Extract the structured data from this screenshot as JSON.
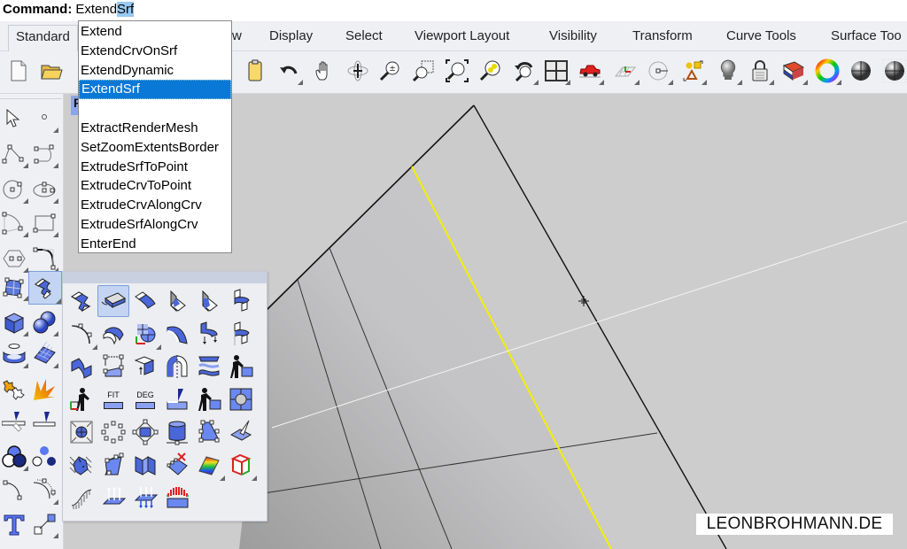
{
  "command": {
    "label": "Command:",
    "typed_prefix": "Extend",
    "autocomplete_suffix": "Srf"
  },
  "tabs": [
    {
      "label": "Standard",
      "active": true
    },
    {
      "label": "View",
      "visible_label": "w"
    },
    {
      "label": "Display"
    },
    {
      "label": "Select"
    },
    {
      "label": "Viewport Layout"
    },
    {
      "label": "Visibility"
    },
    {
      "label": "Transform"
    },
    {
      "label": "Curve Tools"
    },
    {
      "label": "Surface Tools",
      "visible_label": "Surface Too"
    }
  ],
  "autocomplete": {
    "items": [
      "Extend",
      "ExtendCrvOnSrf",
      "ExtendDynamic",
      "ExtendSrf",
      "",
      "ExtractRenderMesh",
      "SetZoomExtentsBorder",
      "ExtrudeSrfToPoint",
      "ExtrudeCrvToPoint",
      "ExtrudeCrvAlongCrv",
      "ExtrudeSrfAlongCrv",
      "EnterEnd"
    ],
    "selected_index": 3,
    "selected_color": "#0a78d7"
  },
  "toolbar": {
    "icons": [
      "new-document-icon",
      "open-folder-icon",
      "save-icon",
      "paste-icon",
      "undo-icon",
      "pan-hand-icon",
      "rotate-view-icon",
      "zoom-dynamic-icon",
      "zoom-window-icon",
      "zoom-extents-icon",
      "zoom-selected-icon",
      "undo-view-change-icon",
      "four-viewports-icon",
      "named-views-car-icon",
      "construction-plane-icon",
      "osnap-icon",
      "select-objects-icon",
      "lights-icon",
      "lock-icon",
      "layer-properties-icon",
      "color-wheel-icon",
      "shaded-viewport-icon",
      "rendered-viewport-icon"
    ]
  },
  "sidebar": {
    "icons": [
      "select-arrow-icon",
      "point-icon",
      "polyline-icon",
      "curve-icon",
      "circle-icon",
      "ellipse-icon",
      "arc-icon",
      "rectangle-icon",
      "polygon-icon",
      "fillet-curves-icon",
      "surface-from-points-icon",
      "extend-surface-icon",
      "box-solid-icon",
      "sphere-union-icon",
      "cylinder-mesh-icon",
      "mesh-plane-icon",
      "explode-join-icon",
      "boolean-split-icon",
      "trim-icon",
      "split-icon",
      "boolean-union-icon",
      "boolean-difference-icon",
      "offset-curve-icon",
      "blend-curve-icon",
      "text-object-icon",
      "scale-transform-icon"
    ],
    "selected": "extend-surface-icon"
  },
  "viewport": {
    "tab_label": "P",
    "watermark": "LEONBROHMANN.DE",
    "highlight_edge_color": "#f4ef00"
  },
  "surface_panel": {
    "rows": [
      [
        "extend-surface-icon",
        "extend-surface-to-edge-icon",
        "fillet-surface-icon",
        "chamfer-surface-icon",
        "variable-chamfer-icon",
        "blend-surface-icon"
      ],
      [
        "fillet-edge-icon",
        "offset-surface-icon",
        "rebuild-uv-icon",
        "variable-fillet-icon",
        "connect-surface-icon",
        "match-surface-icon"
      ],
      [
        "symmetric-blend-icon",
        "adjust-seam-icon",
        "offset-surface-loose-icon",
        "bend-surface-icon",
        "flow-along-surface-icon",
        "man-edit-icon"
      ],
      [
        "man-place-icon",
        "fit-surface-icon",
        "change-degree-icon",
        "trim-split-icon",
        "man-rebuild-icon",
        "untrim-icon"
      ],
      [
        "shrink-trimmed-icon",
        "control-points-icon",
        "cage-edit-icon",
        "cylinder-icon",
        "wireframe-triangle-icon",
        "cut-surface-icon"
      ],
      [
        "analyze-direction-icon",
        "edit-points-curve-icon",
        "unroll-surface-icon",
        "remove-knot-icon",
        "zebra-analysis-icon",
        "bounding-box-icon"
      ],
      [
        "curvature-graph-icon",
        "normals-icon",
        "flip-normals-icon",
        "draft-angle-icon"
      ]
    ],
    "text_icons": {
      "fit": "FIT",
      "deg": "DEG"
    },
    "selected": "extend-surface-to-edge-icon"
  }
}
